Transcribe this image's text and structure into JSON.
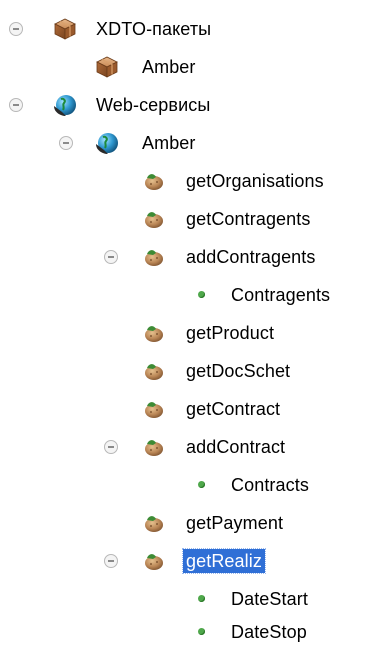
{
  "tree": {
    "xdto_packages": {
      "label": "XDTO-пакеты",
      "expanded": true,
      "children": [
        {
          "label": "Amber"
        }
      ]
    },
    "web_services": {
      "label": "Web-сервисы",
      "expanded": true,
      "service": {
        "label": "Amber",
        "expanded": true,
        "operations": [
          {
            "label": "getOrganisations"
          },
          {
            "label": "getContragents"
          },
          {
            "label": "addContragents",
            "expanded": true,
            "params": [
              {
                "label": "Contragents"
              }
            ]
          },
          {
            "label": "getProduct"
          },
          {
            "label": "getDocSchet"
          },
          {
            "label": "getContract"
          },
          {
            "label": "addContract",
            "expanded": true,
            "params": [
              {
                "label": "Contracts"
              }
            ]
          },
          {
            "label": "getPayment"
          },
          {
            "label": "getRealiz",
            "expanded": true,
            "selected": true,
            "params": [
              {
                "label": "DateStart"
              },
              {
                "label": "DateStop"
              }
            ]
          }
        ]
      }
    }
  },
  "colors": {
    "selection_bg": "#2f6fd6",
    "selection_text": "#ffffff",
    "param_dot": "#4fa84b",
    "toggle_border": "#b8b8b8"
  },
  "icons": {
    "package": "package-icon",
    "web_service": "web-service-icon",
    "operation": "operation-icon",
    "parameter": "parameter-bullet-icon",
    "collapse": "collapse-minus-icon"
  }
}
